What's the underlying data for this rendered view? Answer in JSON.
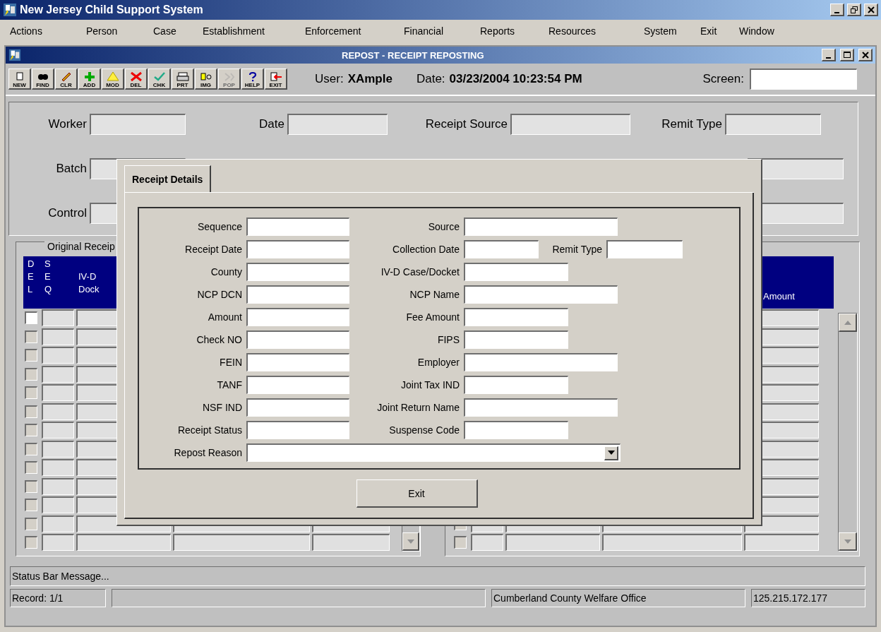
{
  "app": {
    "title": "New Jersey Child Support System"
  },
  "menu": [
    "Actions",
    "Person",
    "Case",
    "Establishment",
    "Enforcement",
    "Financial",
    "Reports",
    "Resources",
    "System",
    "Exit",
    "Window"
  ],
  "window": {
    "title": "REPOST - RECEIPT REPOSTING"
  },
  "toolbar": [
    {
      "label": "NEW",
      "disabled": false
    },
    {
      "label": "FIND",
      "disabled": false
    },
    {
      "label": "CLR",
      "disabled": false
    },
    {
      "label": "ADD",
      "disabled": false
    },
    {
      "label": "MOD",
      "disabled": false
    },
    {
      "label": "DEL",
      "disabled": false
    },
    {
      "label": "CHK",
      "disabled": false
    },
    {
      "label": "PRT",
      "disabled": false
    },
    {
      "label": "IMG",
      "disabled": false
    },
    {
      "label": "POP",
      "disabled": true
    },
    {
      "label": "HELP",
      "disabled": false
    },
    {
      "label": "EXIT",
      "disabled": false
    }
  ],
  "session": {
    "user_label": "User:",
    "user": "XAmple",
    "date_label": "Date:",
    "date": "03/23/2004 10:23:54 PM",
    "screen_label": "Screen:"
  },
  "header_form": {
    "worker": "Worker",
    "date": "Date",
    "receipt_source": "Receipt Source",
    "remit_type": "Remit Type",
    "batch": "Batch",
    "control": "Control"
  },
  "grid_left": {
    "title": "Original Receip",
    "columns": [
      "D\nE\nL",
      "S\nE\nQ",
      "IV-D\nDock"
    ]
  },
  "grid_right": {
    "columns": [
      "Amount"
    ]
  },
  "grid_rows": [
    {
      "disabled": false
    },
    {
      "disabled": true
    },
    {
      "disabled": true
    },
    {
      "disabled": true
    },
    {
      "disabled": true
    },
    {
      "disabled": true
    },
    {
      "disabled": true
    },
    {
      "disabled": true
    },
    {
      "disabled": true
    },
    {
      "disabled": true
    },
    {
      "disabled": true
    },
    {
      "disabled": true
    },
    {
      "disabled": true
    }
  ],
  "dialog": {
    "tabs": [
      {
        "label": "Receipt Details",
        "selected": true
      }
    ],
    "left_fields": [
      {
        "label": "Sequence"
      },
      {
        "label": "Receipt Date"
      },
      {
        "label": "County"
      },
      {
        "label": "NCP DCN"
      },
      {
        "label": "Amount"
      },
      {
        "label": "Check NO"
      },
      {
        "label": "FEIN"
      },
      {
        "label": "TANF"
      },
      {
        "label": "NSF IND"
      },
      {
        "label": "Receipt Status"
      }
    ],
    "right_fields": [
      {
        "label": "Source",
        "kind": "long"
      },
      {
        "label": "Collection Date",
        "kind": "short"
      },
      {
        "label": "IV-D Case/Docket",
        "kind": "medium"
      },
      {
        "label": "NCP Name",
        "kind": "long"
      },
      {
        "label": "Fee Amount",
        "kind": "medium"
      },
      {
        "label": "FIPS",
        "kind": "medium"
      },
      {
        "label": "Employer",
        "kind": "long"
      },
      {
        "label": "Joint Tax IND",
        "kind": "medium"
      },
      {
        "label": "Joint Return Name",
        "kind": "long"
      },
      {
        "label": "Suspense Code",
        "kind": "medium"
      }
    ],
    "extra_field": {
      "label": "Remit Type"
    },
    "reason": {
      "label": "Repost Reason"
    },
    "exit_button": "Exit"
  },
  "status_bar": {
    "message": "Status Bar Message...",
    "record": "Record: 1/1",
    "office": "Cumberland County Welfare Office",
    "address": "125.215.172.177"
  }
}
